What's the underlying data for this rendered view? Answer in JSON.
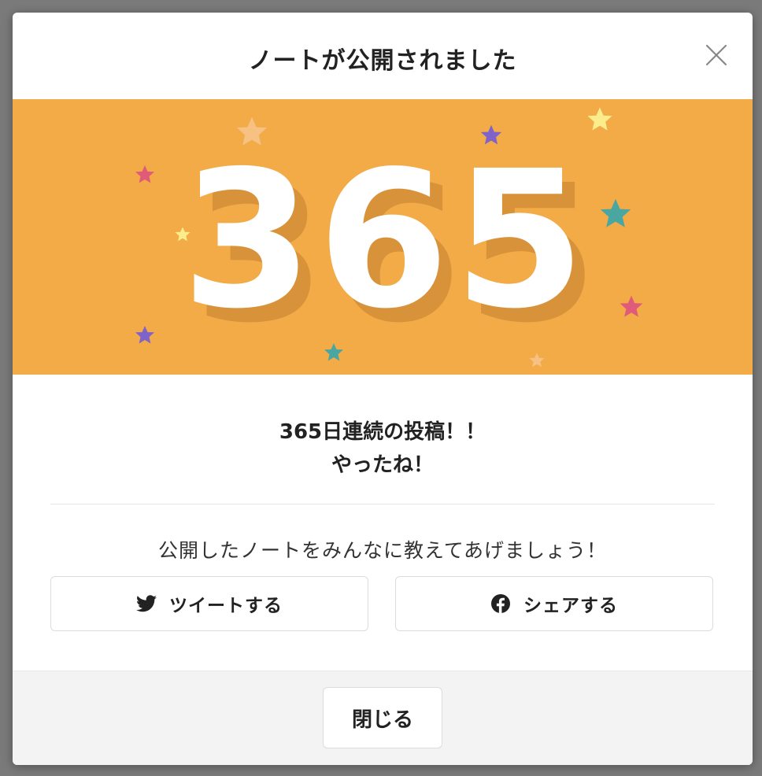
{
  "modal": {
    "title": "ノートが公開されました",
    "banner_number": "365",
    "message_line1": "365日連続の投稿！！",
    "message_line2": "やったね！",
    "share_prompt": "公開したノートをみんなに教えてあげましょう！",
    "tweet_label": "ツイートする",
    "share_label": "シェアする",
    "close_label": "閉じる"
  },
  "icons": {
    "close": "close-icon",
    "twitter": "twitter-icon",
    "facebook": "facebook-icon"
  },
  "colors": {
    "banner": "#f2ab47",
    "overlay": "#7a7a7a"
  }
}
